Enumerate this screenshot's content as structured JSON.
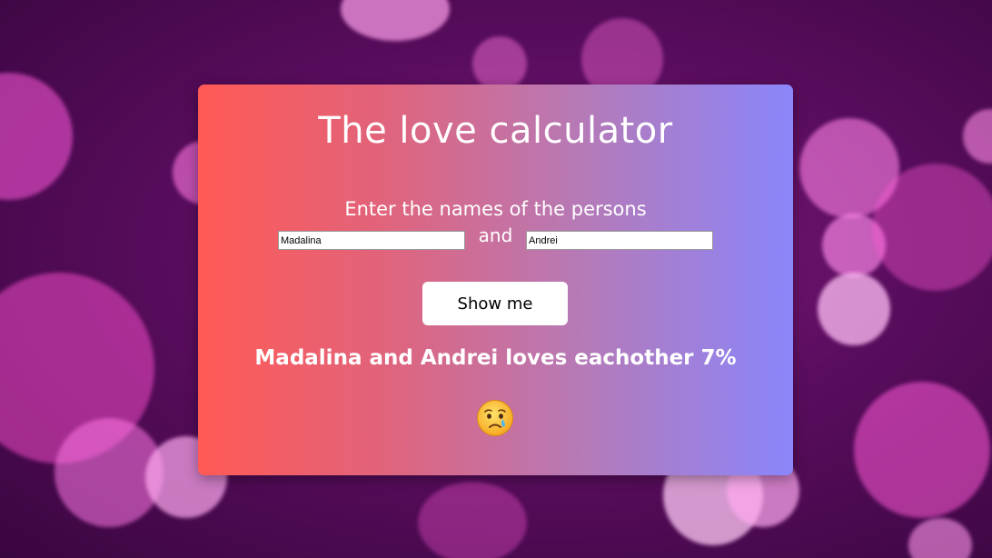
{
  "app": {
    "title": "The love calculator",
    "prompt": "Enter the names of the persons",
    "and_label": "and",
    "first_name_value": "Madalina",
    "second_name_value": "Andrei",
    "button_label": "Show me",
    "result_text": "Madalina and Andrei loves eachother 7%",
    "result_icon": "crying-face-icon"
  },
  "colors": {
    "card_gradient_start": "#ff5a55",
    "card_gradient_end": "#8a86fb",
    "background": "#5a0d5e",
    "bokeh": "#ff4fd8"
  }
}
